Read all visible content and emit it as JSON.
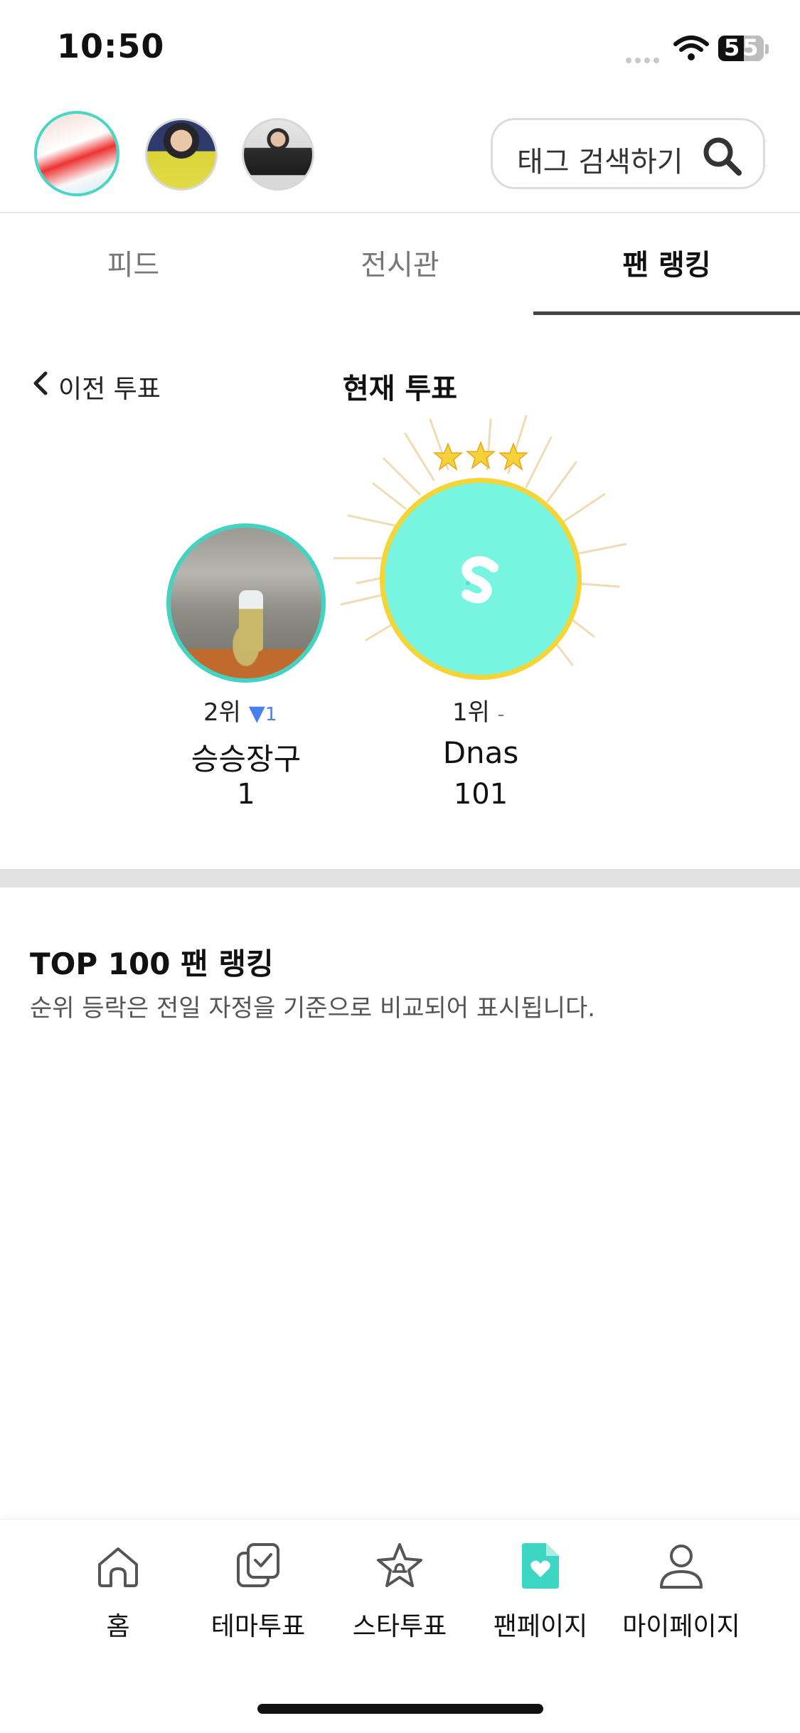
{
  "status": {
    "time": "10:50",
    "battery": "55"
  },
  "header": {
    "avatars": [
      "avatar-1",
      "avatar-2",
      "avatar-3"
    ],
    "search_label": "태그 검색하기"
  },
  "tabs": [
    {
      "label": "피드",
      "active": false
    },
    {
      "label": "전시관",
      "active": false
    },
    {
      "label": "팬 랭킹",
      "active": true
    }
  ],
  "vote": {
    "prev_label": "이전 투표",
    "current_label": "현재 투표"
  },
  "podium": {
    "first": {
      "rank": "1위",
      "change": "-",
      "name": "Dnas",
      "score": "101",
      "stars": 3
    },
    "second": {
      "rank": "2위",
      "change_symbol": "▼",
      "change": "1",
      "name": "승승장구",
      "score": "1"
    }
  },
  "ranking": {
    "title": "TOP 100 팬 랭킹",
    "description": "순위 등락은 전일 자정을 기준으로 비교되어 표시됩니다."
  },
  "nav": [
    {
      "label": "홈",
      "icon": "home-icon"
    },
    {
      "label": "테마투표",
      "icon": "theme-vote-icon"
    },
    {
      "label": "스타투표",
      "icon": "star-vote-icon"
    },
    {
      "label": "팬페이지",
      "icon": "fan-page-icon",
      "active": true
    },
    {
      "label": "마이페이지",
      "icon": "my-page-icon"
    }
  ],
  "colors": {
    "accent": "#48d6c6",
    "winner_fill": "#78f5e1",
    "winner_border": "#f4d535",
    "rank_down": "#4a7ff2"
  }
}
